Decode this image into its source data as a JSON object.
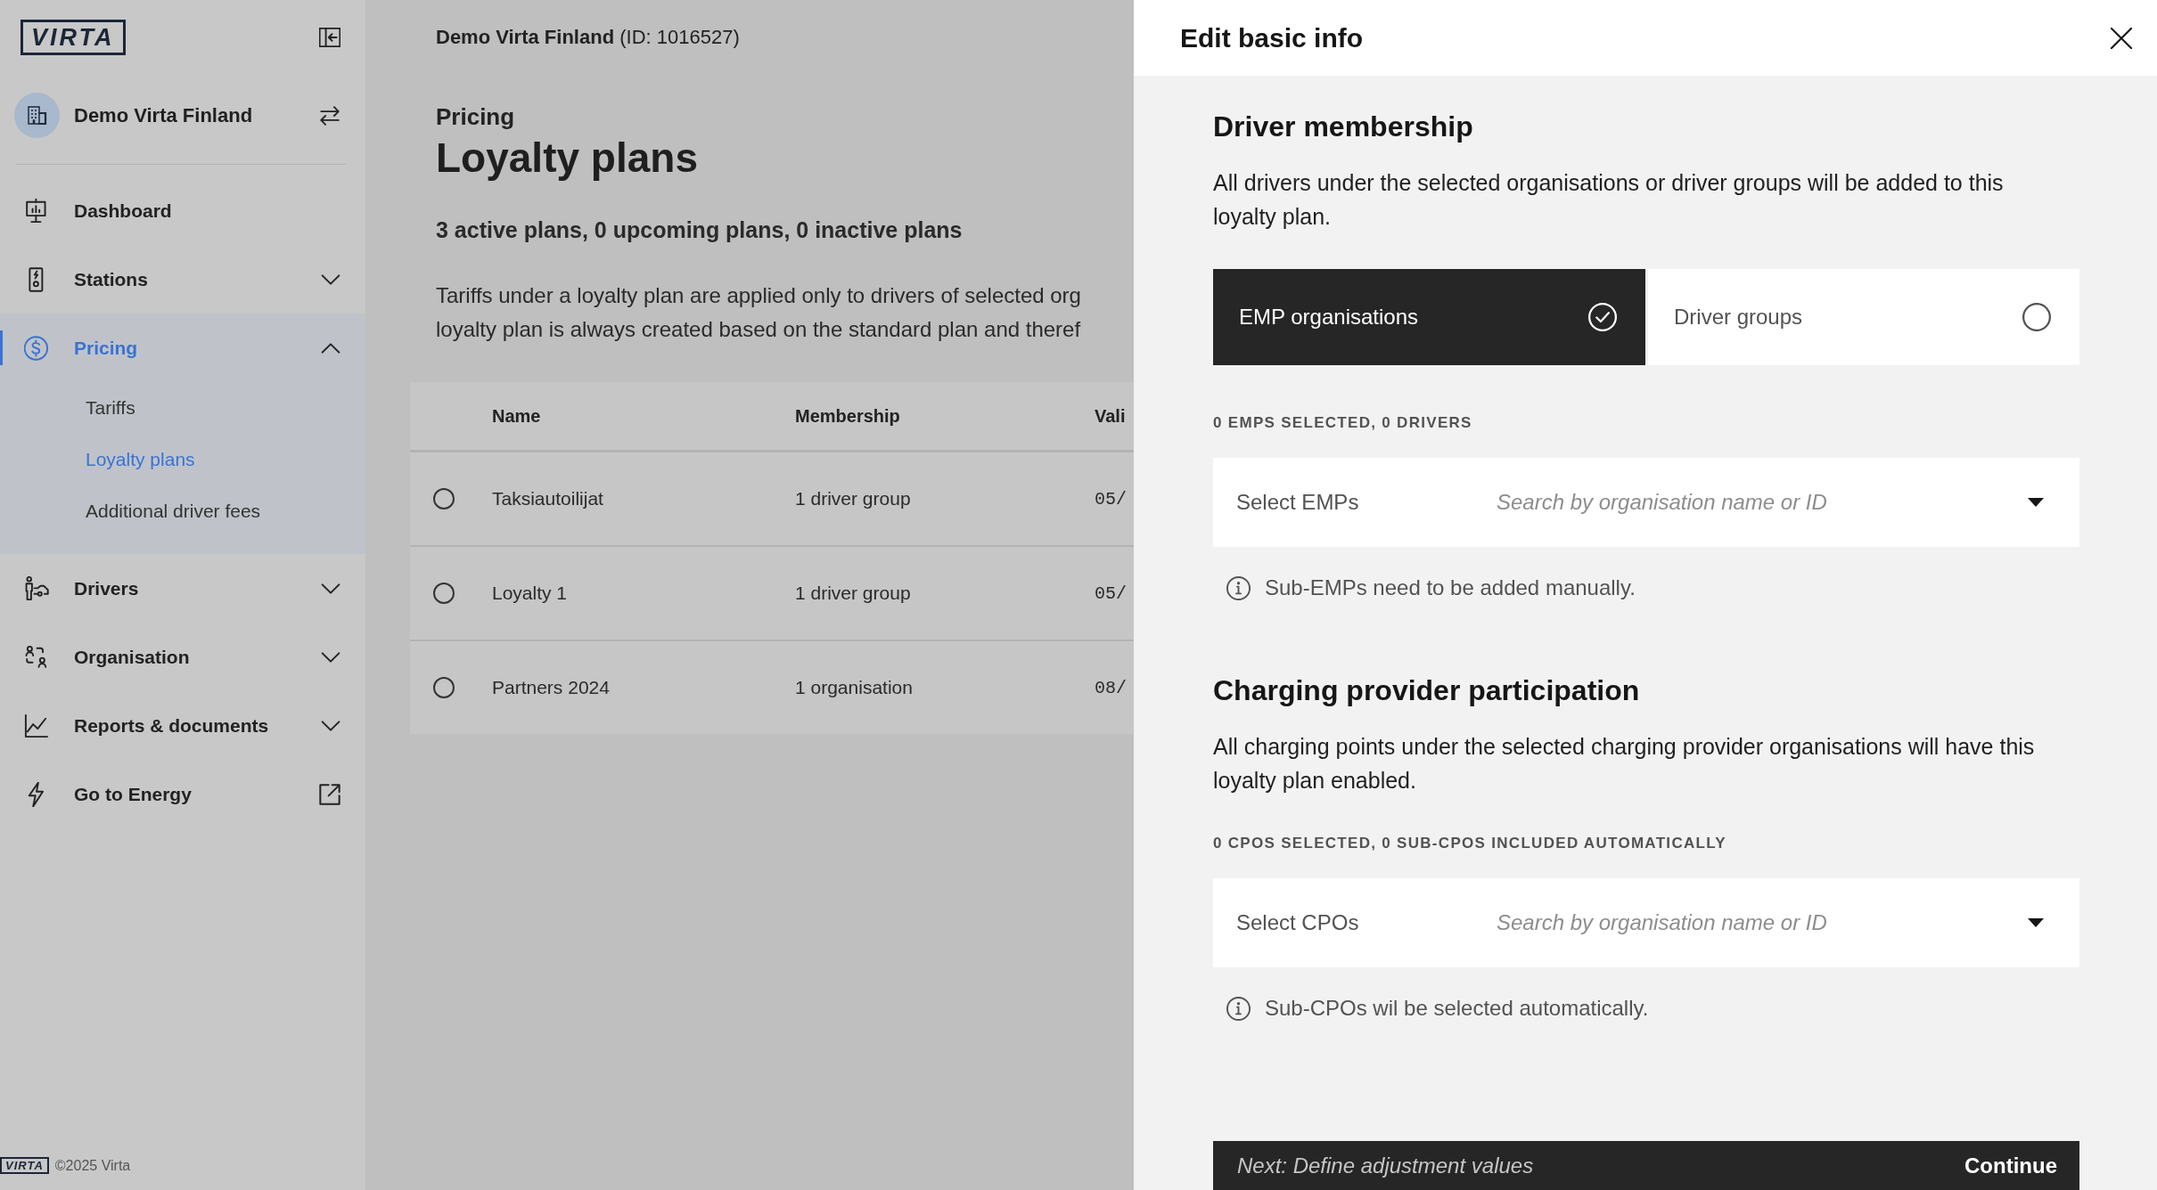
{
  "sidebar": {
    "logo": "VIRTA",
    "organisation": "Demo Virta Finland",
    "nav": [
      {
        "label": "Dashboard",
        "kind": "page",
        "selected": false
      },
      {
        "label": "Stations",
        "kind": "group",
        "selected": false,
        "expanded": false
      },
      {
        "label": "Pricing",
        "kind": "group",
        "selected": true,
        "expanded": true,
        "children": [
          {
            "label": "Tariffs",
            "selected": false
          },
          {
            "label": "Loyalty plans",
            "selected": true
          },
          {
            "label": "Additional driver fees",
            "selected": false
          }
        ]
      },
      {
        "label": "Drivers",
        "kind": "group",
        "selected": false,
        "expanded": false
      },
      {
        "label": "Organisation",
        "kind": "group",
        "selected": false,
        "expanded": false
      },
      {
        "label": "Reports & documents",
        "kind": "group",
        "selected": false,
        "expanded": false
      },
      {
        "label": "Go to Energy",
        "kind": "external",
        "selected": false
      }
    ],
    "footer": {
      "logo": "VIRTA",
      "copyright": "©2025 Virta"
    }
  },
  "main": {
    "account": "**Demo Virta Finland** (ID: 1016527)",
    "breadcrumb": "Pricing",
    "title": "Loyalty plans",
    "summary": "3 active plans, 0 upcoming plans, 0 inactive plans",
    "intro_lines": [
      "Tariffs under a loyalty plan are applied only to drivers of selected org",
      "loyalty plan is always created based on the standard plan and theref"
    ],
    "table": {
      "columns": [
        "Name",
        "Membership",
        "Vali"
      ],
      "rows": [
        {
          "selected": false,
          "cells": [
            "Taksiautoilijat",
            "1 driver group",
            "05/"
          ]
        },
        {
          "selected": false,
          "cells": [
            "Loyalty 1",
            "1 driver group",
            "05/"
          ]
        },
        {
          "selected": false,
          "cells": [
            "Partners 2024",
            "1 organisation",
            "08/"
          ]
        }
      ]
    }
  },
  "panel": {
    "title": "Edit basic info",
    "sections": [
      {
        "heading": "Driver membership",
        "description": "All drivers under the selected organisations or driver groups will be added to this loyalty plan.",
        "options": [
          {
            "label": "EMP organisations",
            "selected": true
          },
          {
            "label": "Driver groups",
            "selected": false
          }
        ],
        "count_label": "0 EMPS SELECTED, 0 DRIVERS",
        "select": {
          "label": "Select EMPs",
          "placeholder": "Search by organisation name or ID"
        },
        "note": "Sub-EMPs need to be added manually."
      },
      {
        "heading": "Charging provider participation",
        "description": "All charging points under the selected charging provider organisations will have this loyalty plan enabled.",
        "count_label": "0 CPOS SELECTED, 0 SUB-CPOS INCLUDED AUTOMATICALLY",
        "select": {
          "label": "Select CPOs",
          "placeholder": "Search by organisation name or ID"
        },
        "note": "Sub-CPOs wil be selected automatically."
      }
    ],
    "footer": {
      "hint": "Next: Define adjustment values",
      "button": "Continue"
    }
  }
}
